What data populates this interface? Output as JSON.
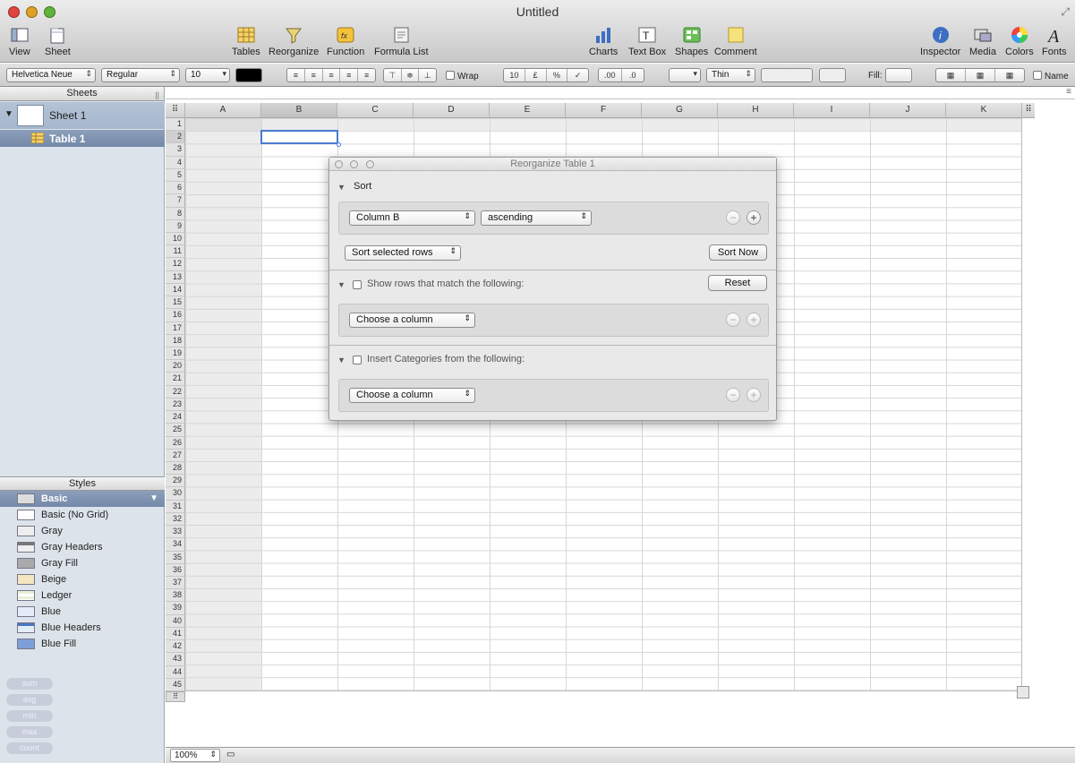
{
  "window": {
    "title": "Untitled"
  },
  "toolbar": {
    "left": [
      {
        "label": "View"
      },
      {
        "label": "Sheet"
      }
    ],
    "center": [
      {
        "label": "Tables"
      },
      {
        "label": "Reorganize"
      },
      {
        "label": "Function"
      },
      {
        "label": "Formula List"
      }
    ],
    "right_center": [
      {
        "label": "Charts"
      },
      {
        "label": "Text Box"
      },
      {
        "label": "Shapes"
      },
      {
        "label": "Comment"
      }
    ],
    "right": [
      {
        "label": "Inspector"
      },
      {
        "label": "Media"
      },
      {
        "label": "Colors"
      },
      {
        "label": "Fonts"
      }
    ]
  },
  "format_bar": {
    "font": "Helvetica Neue",
    "weight": "Regular",
    "size": "10",
    "wrap_label": "Wrap",
    "number_formats": [
      "10",
      "£",
      "%",
      "✓"
    ],
    "decimals": [
      ".00",
      ".0"
    ],
    "stroke": "Thin",
    "fill_label": "Fill:",
    "name_label": "Name"
  },
  "sidebar": {
    "sheets_title": "Sheets",
    "sheet_name": "Sheet 1",
    "table_name": "Table 1",
    "styles_title": "Styles",
    "styles": [
      "Basic",
      "Basic (No Grid)",
      "Gray",
      "Gray Headers",
      "Gray Fill",
      "Beige",
      "Ledger",
      "Blue",
      "Blue Headers",
      "Blue Fill"
    ],
    "functions": [
      "sum",
      "avg",
      "min",
      "max",
      "count"
    ]
  },
  "table": {
    "columns": [
      "A",
      "B",
      "C",
      "D",
      "E",
      "F",
      "G",
      "H",
      "I",
      "J",
      "K"
    ],
    "row_count": 45
  },
  "dialog": {
    "title": "Reorganize Table 1",
    "sort": {
      "label": "Sort",
      "column": "Column B",
      "order": "ascending",
      "scope": "Sort selected rows",
      "sort_now": "Sort Now"
    },
    "filter": {
      "label": "Show rows that match the following:",
      "reset": "Reset",
      "column": "Choose a column"
    },
    "categories": {
      "label": "Insert Categories from the following:",
      "column": "Choose a column"
    }
  },
  "status": {
    "zoom": "100%"
  }
}
